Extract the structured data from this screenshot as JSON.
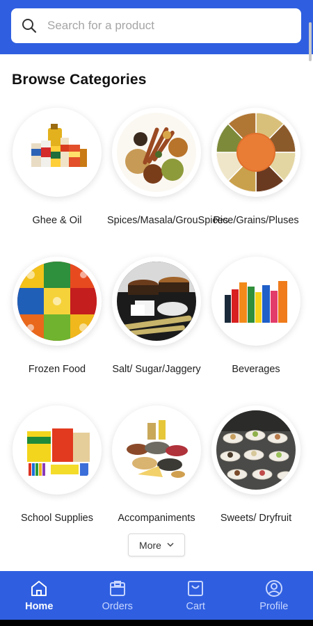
{
  "search": {
    "placeholder": "Search for a product",
    "icon": "search-icon"
  },
  "browse": {
    "title": "Browse Categories",
    "categories": [
      {
        "label": "Ghee & Oil"
      },
      {
        "label": "Spices/Masala/GrouSpices"
      },
      {
        "label": "Rice/Grains/Pluses"
      },
      {
        "label": "Frozen Food"
      },
      {
        "label": "Salt/ Sugar/Jaggery"
      },
      {
        "label": "Beverages"
      },
      {
        "label": "School Supplies"
      },
      {
        "label": "Accompaniments"
      },
      {
        "label": "Sweets/ Dryfruit"
      }
    ],
    "more_label": "More"
  },
  "bottom_nav": {
    "items": [
      {
        "label": "Home",
        "icon": "home-icon",
        "active": true
      },
      {
        "label": "Orders",
        "icon": "orders-icon",
        "active": false
      },
      {
        "label": "Cart",
        "icon": "cart-icon",
        "active": false
      },
      {
        "label": "Profile",
        "icon": "profile-icon",
        "active": false
      }
    ]
  },
  "colors": {
    "brand": "#2f5fe0",
    "nav_inactive": "#c9d6ff",
    "nav_active": "#ffffff"
  }
}
